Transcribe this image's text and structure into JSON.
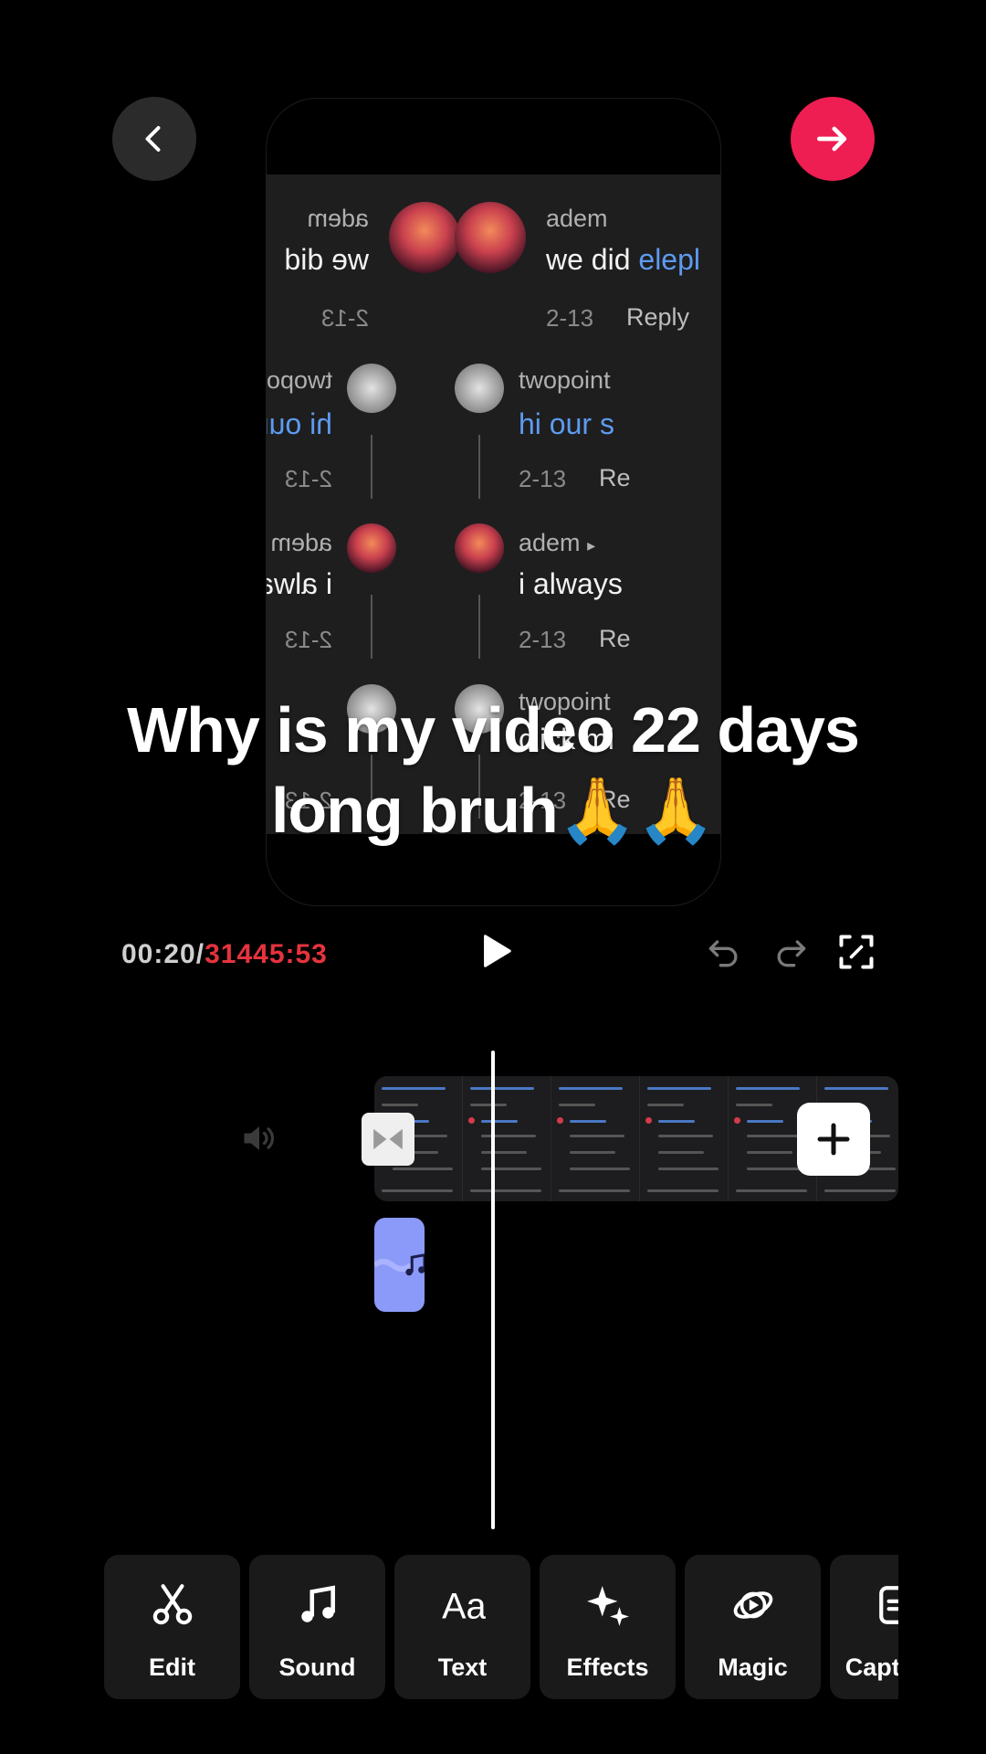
{
  "top_bar": {
    "back_icon": "chevron-left-icon",
    "next_icon": "arrow-right-icon",
    "next_color": "#ee1d52"
  },
  "preview": {
    "comments": [
      {
        "user": "adem",
        "text_plain": "we did ",
        "text_blue": "elepl",
        "date": "2-13",
        "reply": "Reply"
      },
      {
        "user": "twopoint",
        "text_blue": "hi our s",
        "date": "2-13",
        "reply": "Re"
      },
      {
        "user": "adem",
        "text_plain": "i always",
        "date": "2-13",
        "reply": "Re"
      },
      {
        "user": "twopoint",
        "text_plain": "click mi",
        "date": "2-13",
        "reply": "Re"
      }
    ],
    "caption": "Why is my video 22 days long bruh🙏🙏"
  },
  "playback": {
    "current_time": "00:20",
    "separator": "/",
    "total_time": "31445:53",
    "total_color": "#e5333d"
  },
  "timeline": {
    "volume_icon": "speaker-icon",
    "transition_icon": "transition-icon",
    "add_icon": "plus-icon",
    "music_icon": "music-note-icon"
  },
  "toolbar": {
    "items": [
      {
        "label": "Edit",
        "icon": "scissors-icon"
      },
      {
        "label": "Sound",
        "icon": "music-note-icon"
      },
      {
        "label": "Text",
        "icon": "text-aa-icon"
      },
      {
        "label": "Effects",
        "icon": "sparkle-icon"
      },
      {
        "label": "Magic",
        "icon": "magic-icon"
      },
      {
        "label": "Captions",
        "icon": "captions-icon"
      }
    ]
  }
}
